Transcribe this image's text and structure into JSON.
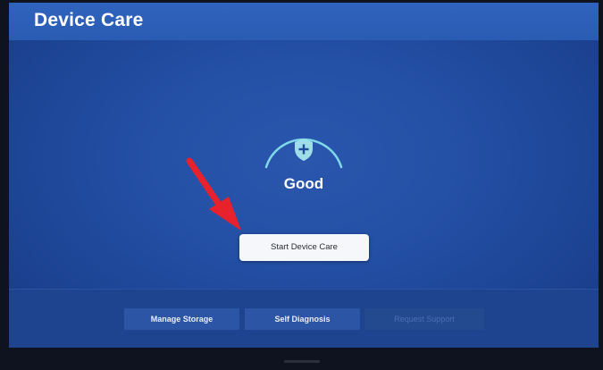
{
  "app": {
    "title": "Device Care"
  },
  "status": {
    "label": "Good",
    "icon": "shield-plus-icon",
    "arc_color": "#7fd9e8"
  },
  "main": {
    "start_button_label": "Start Device Care"
  },
  "bottom_menu": {
    "items": [
      {
        "label": "Manage Storage",
        "enabled": true
      },
      {
        "label": "Self Diagnosis",
        "enabled": true
      },
      {
        "label": "Request Support",
        "enabled": false
      }
    ]
  },
  "annotation": {
    "icon": "red-arrow-icon",
    "color": "#e8222c"
  },
  "colors": {
    "screen_background": "#2450a6",
    "titlebar": "#2f63bd",
    "button_background": "#f6f7fa"
  }
}
